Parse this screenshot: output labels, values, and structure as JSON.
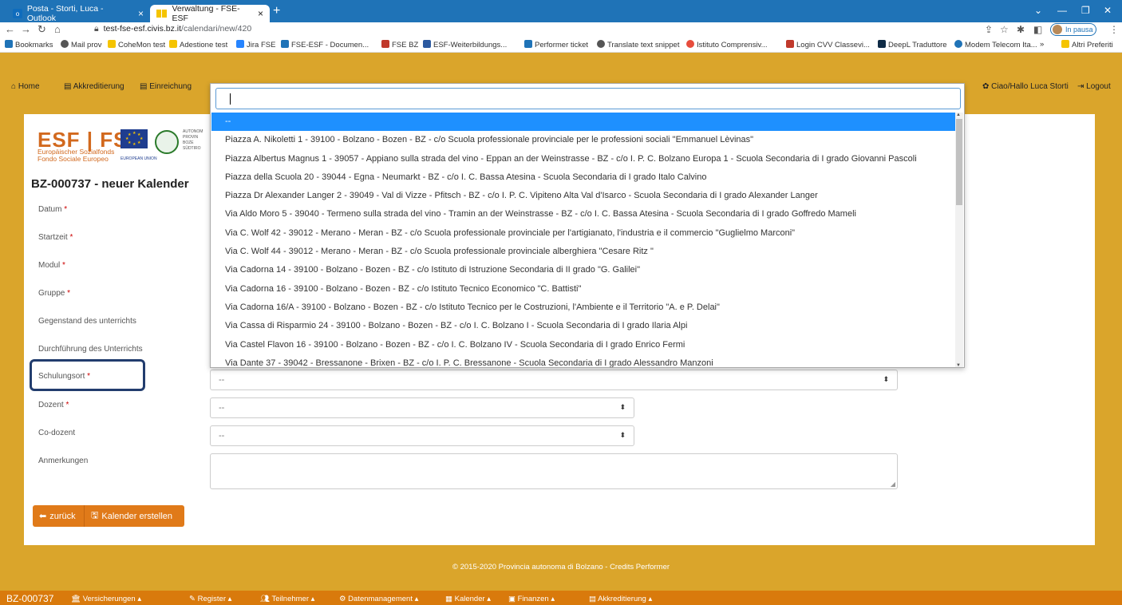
{
  "browser": {
    "tabs": [
      {
        "title": "Posta - Storti, Luca - Outlook"
      },
      {
        "title": "Verwaltung - FSE-ESF"
      }
    ],
    "url_host": "test-fse-esf.civis.bz.it",
    "url_path": "/calendari/new/420",
    "profile_status": "In pausa",
    "bookmarks": [
      "Bookmarks",
      "Mail prov",
      "CoheMon test",
      "Adestione test",
      "Jira FSE",
      "FSE-ESF - Documen...",
      "FSE BZ",
      "ESF-Weiterbildungs...",
      "Performer ticket",
      "Translate text snippet",
      "Istituto Comprensiv...",
      "Login CVV Classevi...",
      "DeepL Traduttore",
      "Modem Telecom Ita...",
      "»",
      "Altri Preferiti"
    ]
  },
  "nav": {
    "home": "Home",
    "akkreditierung": "Akkreditierung",
    "einreichung": "Einreichung",
    "user": "Ciao/Hallo Luca Storti",
    "logout": "Logout"
  },
  "logo": {
    "esf": "ESF | FSE",
    "line1": "Europäischer Sozialfonds",
    "line2": "Fondo Sociale Europeo",
    "eu": "EUROPEAN UNION",
    "auton": [
      "AUTONOM",
      "PROVIN",
      "BOZE",
      "SÜDTIRO"
    ]
  },
  "page": {
    "title": "BZ-000737 - neuer Kalender"
  },
  "form": {
    "labels": {
      "datum": "Datum",
      "startzeit": "Startzeit",
      "modul": "Modul",
      "gruppe": "Gruppe",
      "gegenstand": "Gegenstand des unterrichts",
      "durchfuehrung": "Durchführung des Unterrichts",
      "schulungsort": "Schulungsort",
      "dozent": "Dozent",
      "codozent": "Co-dozent",
      "anmerkungen": "Anmerkungen",
      "required_mark": "*"
    },
    "schulungsort_value": "--",
    "dozent_value": "--",
    "codozent_value": "--",
    "back_button": "zurück",
    "create_button": "Kalender erstellen"
  },
  "dropdown": {
    "search_value": "",
    "options": [
      "--",
      "Piazza A. Nikoletti 1 - 39100 - Bolzano - Bozen - BZ - c/o Scuola professionale provinciale per le professioni sociali \"Emmanuel Lèvinas\"",
      "Piazza Albertus Magnus 1 - 39057 - Appiano sulla strada del vino - Eppan an der Weinstrasse - BZ - c/o I. P. C. Bolzano Europa 1 - Scuola Secondaria di I grado Giovanni Pascoli",
      "Piazza della Scuola 20 - 39044 - Egna - Neumarkt - BZ - c/o I. C. Bassa Atesina - Scuola Secondaria di I grado Italo Calvino",
      "Piazza Dr Alexander Langer 2 - 39049 - Val di Vizze - Pfitsch - BZ - c/o I. P. C. Vipiteno Alta Val d'Isarco - Scuola Secondaria di I grado Alexander Langer",
      "Via Aldo Moro 5 - 39040 - Termeno sulla strada del vino - Tramin an der Weinstrasse - BZ - c/o I. C. Bassa Atesina - Scuola Secondaria di I grado Goffredo Mameli",
      "Via C. Wolf 42 - 39012 - Merano - Meran - BZ - c/o Scuola professionale provinciale per l'artigianato, l'industria e il commercio \"Guglielmo Marconi\"",
      "Via C. Wolf 44 - 39012 - Merano - Meran - BZ - c/o Scuola professionale provinciale alberghiera \"Cesare Ritz \"",
      "Via Cadorna 14 - 39100 - Bolzano - Bozen - BZ - c/o Istituto di Istruzione Secondaria di II grado \"G. Galilei\"",
      "Via Cadorna 16 - 39100 - Bolzano - Bozen - BZ - c/o Istituto Tecnico Economico \"C. Battisti\"",
      "Via Cadorna 16/A - 39100 - Bolzano - Bozen - BZ - c/o Istituto Tecnico per le Costruzioni, l'Ambiente e il Territorio \"A. e P. Delai\"",
      "Via Cassa di Risparmio 24 - 39100 - Bolzano - Bozen - BZ - c/o I. C. Bolzano I - Scuola Secondaria di I grado Ilaria Alpi",
      "Via Castel Flavon 16 - 39100 - Bolzano - Bozen - BZ - c/o I. C. Bolzano IV - Scuola Secondaria di I grado Enrico Fermi",
      "Via Dante 37 - 39042 - Bressanone - Brixen - BZ - c/o I. P. C. Bressanone - Scuola Secondaria di I grado Alessandro Manzoni"
    ]
  },
  "footer": {
    "copyright": "© 2015-2020 Provincia autonoma di Bolzano - Credits Performer"
  },
  "bottombar": {
    "id": "BZ-000737",
    "items": [
      "Versicherungen",
      "Register",
      "Teilnehmer",
      "Datenmanagement",
      "Kalender",
      "Finanzen",
      "Akkreditierung"
    ]
  },
  "colors": {
    "navbar_bg": "#daa52b",
    "button_bg": "#e07a19",
    "bottombar_bg": "#d97a0c",
    "selected_option": "#1e90ff",
    "highlight_border": "#223d6e"
  }
}
